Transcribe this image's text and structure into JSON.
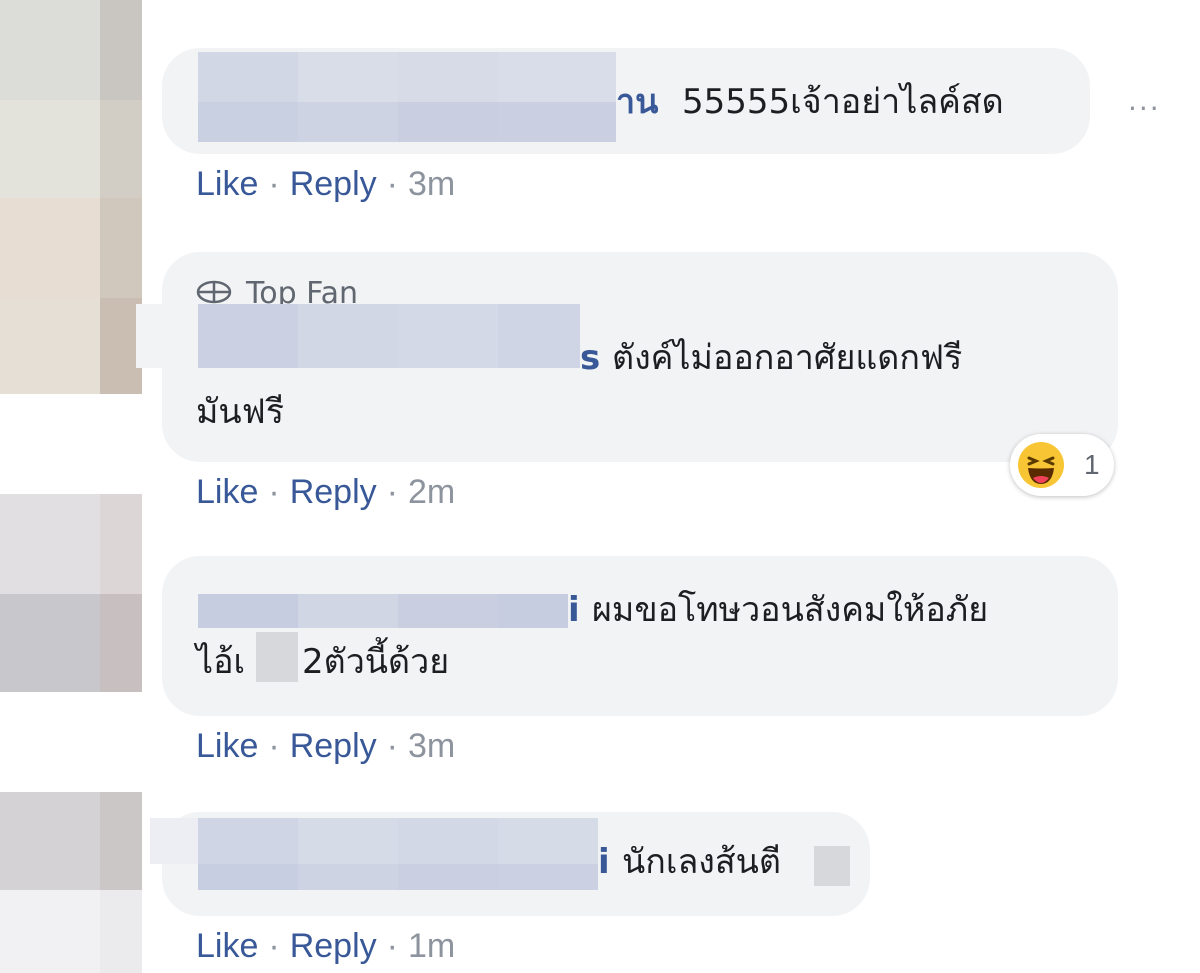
{
  "comments": [
    {
      "name_tail": "าน",
      "text_lines": [
        "55555เจ้าอย่าไลค์สด"
      ],
      "actions": {
        "like": "Like",
        "reply": "Reply",
        "time": "3m"
      }
    },
    {
      "badge": "Top Fan",
      "badge_icon": "top-fan-icon",
      "name_tail": "s",
      "text_lines": [
        "ตังค์ไม่ออกอาศัยแดกฟรี",
        "มันฟรี"
      ],
      "reaction": {
        "icon": "haha-emoji-icon",
        "count": "1"
      },
      "actions": {
        "like": "Like",
        "reply": "Reply",
        "time": "2m"
      }
    },
    {
      "name_tail": "i",
      "text_lines": [
        "ผมขอโทษวอนสังคมให้อภัย",
        "ไอ้เ",
        "2ตัวนี้ด้วย"
      ],
      "actions": {
        "like": "Like",
        "reply": "Reply",
        "time": "3m"
      }
    },
    {
      "name_tail": "i",
      "text_lines": [
        "นักเลงส้นตี"
      ],
      "actions": {
        "like": "Like",
        "reply": "Reply",
        "time": "1m"
      }
    }
  ],
  "more_menu": "···",
  "action_separator": "·",
  "colors": {
    "link": "#385898",
    "bubble": "#f2f3f5",
    "meta": "#8d949e"
  }
}
